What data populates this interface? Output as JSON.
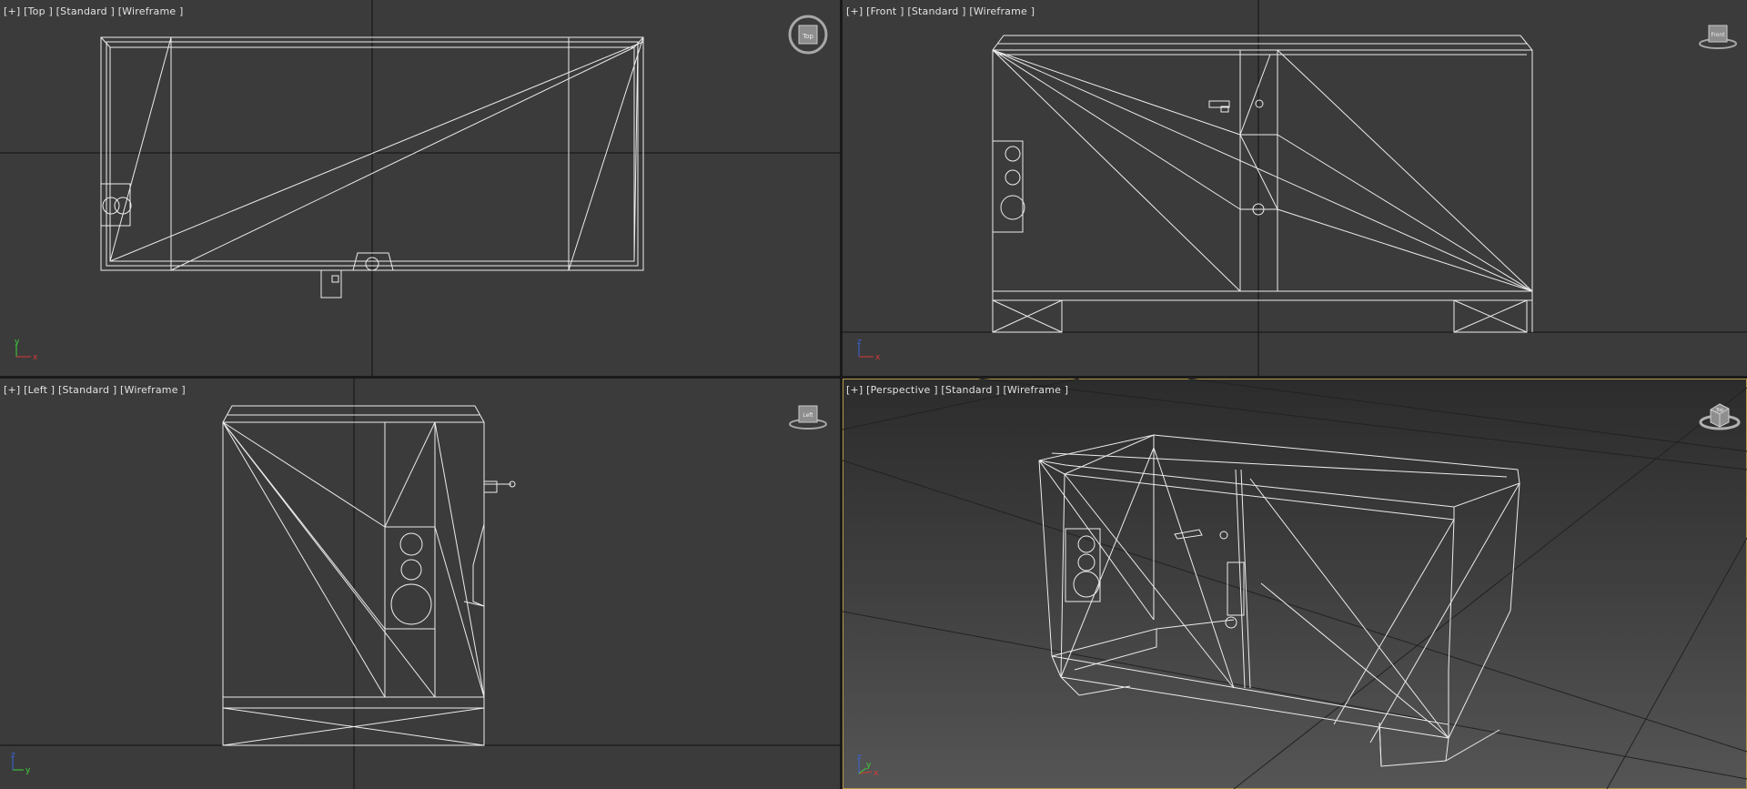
{
  "viewports": {
    "top": {
      "plus": "[+]",
      "view": "[Top ]",
      "shading": "[Standard ]",
      "mode": "[Wireframe ]"
    },
    "front": {
      "plus": "[+]",
      "view": "[Front ]",
      "shading": "[Standard ]",
      "mode": "[Wireframe ]"
    },
    "left": {
      "plus": "[+]",
      "view": "[Left ]",
      "shading": "[Standard ]",
      "mode": "[Wireframe ]"
    },
    "perspective": {
      "plus": "[+]",
      "view": "[Perspective ]",
      "shading": "[Standard ]",
      "mode": "[Wireframe ]"
    }
  },
  "viewcube": {
    "top": "Top",
    "front": "Front",
    "left": "Left",
    "perspective": "Top"
  },
  "axis_labels": {
    "x": "x",
    "y": "y",
    "z": "z"
  },
  "colors": {
    "axis_x": "#d83a3a",
    "axis_y": "#3ed33e",
    "axis_z": "#3a64d8",
    "active_border": "#b49a48",
    "wire": "#ececec"
  },
  "active_viewport": "perspective"
}
